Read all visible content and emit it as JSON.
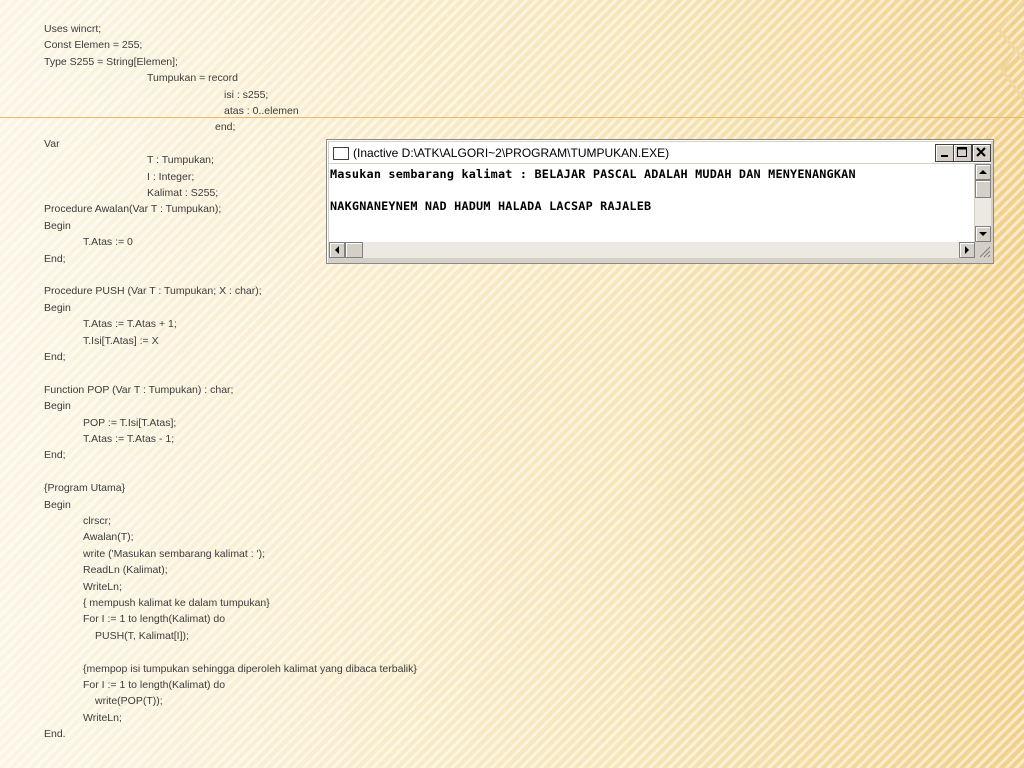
{
  "code_lines": [
    {
      "text": "Uses wincrt;",
      "indent": 0
    },
    {
      "text": "Const Elemen = 255;",
      "indent": 0
    },
    {
      "text": "Type S255 = String[Elemen];",
      "indent": 0
    },
    {
      "text": "Tumpukan = record",
      "indent": 103
    },
    {
      "text": "isi : s255;",
      "indent": 180
    },
    {
      "text": "atas : 0..elemen",
      "indent": 180
    },
    {
      "text": "end;",
      "indent": 171
    },
    {
      "text": "Var",
      "indent": 0
    },
    {
      "text": "T : Tumpukan;",
      "indent": 103
    },
    {
      "text": "I : Integer;",
      "indent": 103
    },
    {
      "text": "Kalimat : S255;",
      "indent": 103
    },
    {
      "text": "Procedure Awalan(Var T : Tumpukan);",
      "indent": 0
    },
    {
      "text": "Begin",
      "indent": 0
    },
    {
      "text": "T.Atas := 0",
      "indent": 39
    },
    {
      "text": "End;",
      "indent": 0
    },
    {
      "text": "",
      "indent": 0
    },
    {
      "text": "Procedure PUSH (Var T : Tumpukan; X : char);",
      "indent": 0
    },
    {
      "text": "Begin",
      "indent": 0
    },
    {
      "text": "T.Atas := T.Atas + 1;",
      "indent": 39
    },
    {
      "text": "T.Isi[T.Atas] := X",
      "indent": 39
    },
    {
      "text": "End;",
      "indent": 0
    },
    {
      "text": "",
      "indent": 0
    },
    {
      "text": "Function POP (Var T : Tumpukan) : char;",
      "indent": 0
    },
    {
      "text": "Begin",
      "indent": 0
    },
    {
      "text": "POP := T.Isi[T.Atas];",
      "indent": 39
    },
    {
      "text": "T.Atas := T.Atas - 1;",
      "indent": 39
    },
    {
      "text": "End;",
      "indent": 0
    },
    {
      "text": "",
      "indent": 0
    },
    {
      "text": "{Program Utama}",
      "indent": 0
    },
    {
      "text": "Begin",
      "indent": 0
    },
    {
      "text": "clrscr;",
      "indent": 39
    },
    {
      "text": "Awalan(T);",
      "indent": 39
    },
    {
      "text": "write ('Masukan sembarang kalimat : ');",
      "indent": 39
    },
    {
      "text": "ReadLn (Kalimat);",
      "indent": 39
    },
    {
      "text": "WriteLn;",
      "indent": 39
    },
    {
      "text": "{ mempush kalimat ke dalam tumpukan}",
      "indent": 39
    },
    {
      "text": "For I := 1 to length(Kalimat) do",
      "indent": 39
    },
    {
      "text": "PUSH(T, Kalimat[I]);",
      "indent": 51
    },
    {
      "text": "",
      "indent": 0
    },
    {
      "text": "{mempop isi tumpukan sehingga diperoleh kalimat yang dibaca terbalik}",
      "indent": 39
    },
    {
      "text": "For I := 1 to length(Kalimat) do",
      "indent": 39
    },
    {
      "text": "write(POP(T));",
      "indent": 51
    },
    {
      "text": "WriteLn;",
      "indent": 39
    },
    {
      "text": "End.",
      "indent": 0
    }
  ],
  "window": {
    "title": "(Inactive D:\\ATK\\ALGORI~2\\PROGRAM\\TUMPUKAN.EXE)",
    "console_lines": [
      "Masukan sembarang kalimat : BELAJAR PASCAL ADALAH MUDAH DAN MENYENANGKAN",
      "",
      "NAKGNANEYNEM NAD HADUM HALADA LACSAP RAJALEB"
    ]
  },
  "colors": {
    "background": "#fbf3dc",
    "accent": "#e8b35a",
    "code_text": "#3c3c3c",
    "console_text": "#000000"
  }
}
